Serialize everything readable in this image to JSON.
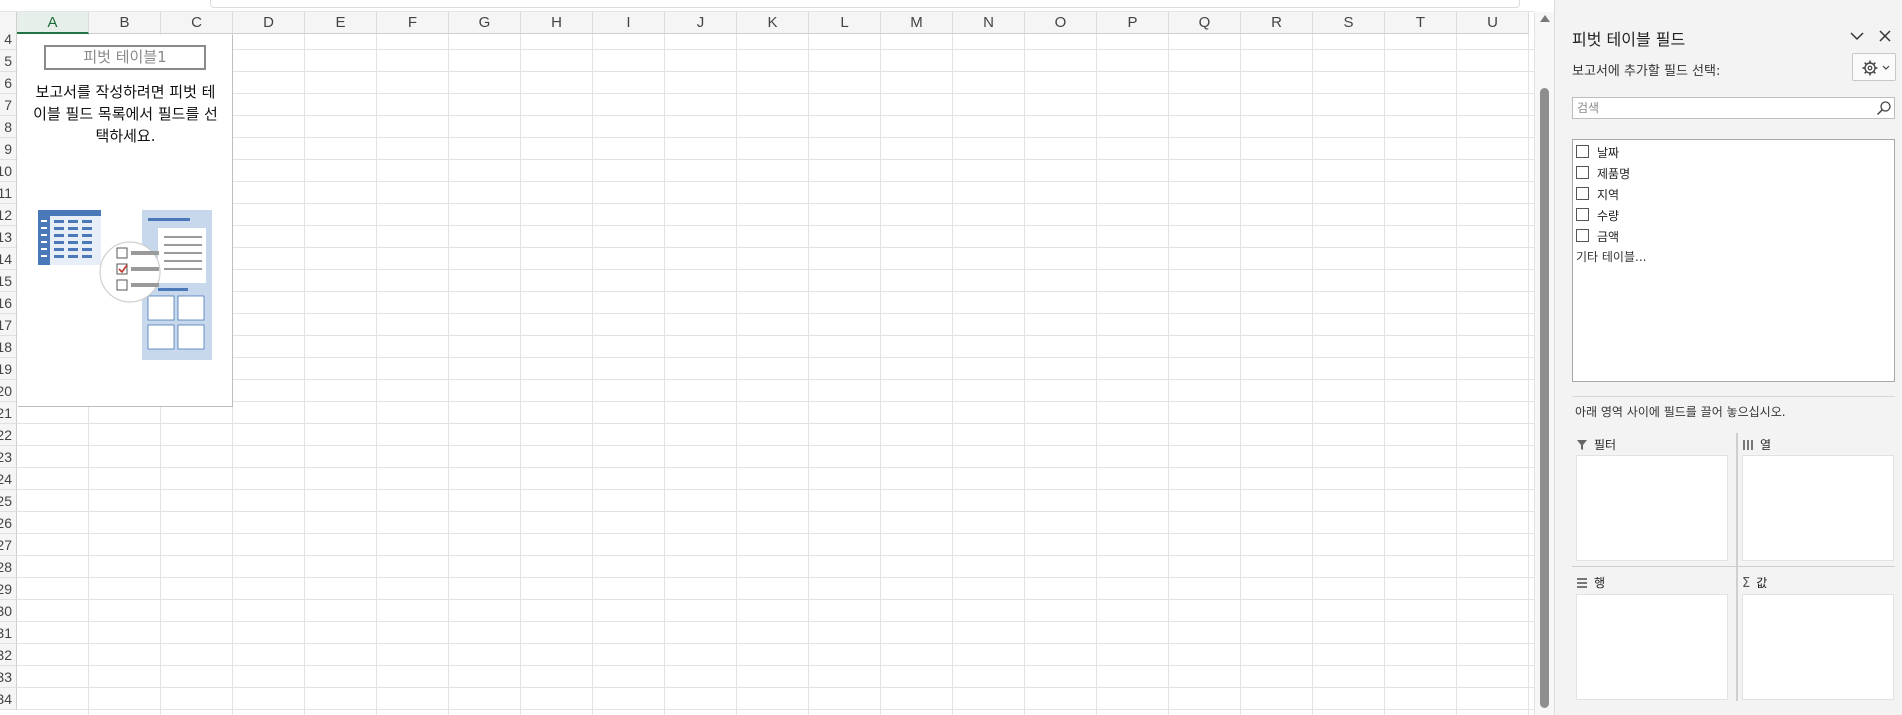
{
  "columns": [
    "A",
    "B",
    "C",
    "D",
    "E",
    "F",
    "G",
    "H",
    "I",
    "J",
    "K",
    "L",
    "M",
    "N",
    "O",
    "P",
    "Q",
    "R",
    "S",
    "T",
    "U"
  ],
  "active_column": "A",
  "rows": [
    "4",
    "5",
    "6",
    "7",
    "8",
    "9",
    "10",
    "11",
    "12",
    "13",
    "14",
    "15",
    "16",
    "17",
    "18",
    "19",
    "20",
    "21",
    "22",
    "23",
    "24",
    "25",
    "26",
    "27",
    "28",
    "29",
    "30",
    "31",
    "32",
    "33",
    "34"
  ],
  "pivot_placeholder": {
    "name": "피벗 테이블1",
    "help_lines": [
      "보고서를 작성하려면 피벗 테",
      "이블 필드 목록에서 필드를 선",
      "택하세요."
    ]
  },
  "pane": {
    "title": "피벗 테이블 필드",
    "subtitle": "보고서에 추가할 필드 선택:",
    "search_placeholder": "검색",
    "fields": [
      {
        "label": "날짜",
        "checked": false
      },
      {
        "label": "제품명",
        "checked": false
      },
      {
        "label": "지역",
        "checked": false
      },
      {
        "label": "수량",
        "checked": false
      },
      {
        "label": "금액",
        "checked": false
      }
    ],
    "more_tables": "기타 테이블...",
    "drag_hint": "아래 영역 사이에 필드를 끌어 놓으십시오.",
    "areas": {
      "filters": "필터",
      "columns": "열",
      "rows": "행",
      "values": "값"
    }
  },
  "colors": {
    "accent": "#217346",
    "checkbox_red": "#c0392b",
    "illustration_blue": "#4a78b8",
    "illustration_light": "#c7d7ec"
  }
}
